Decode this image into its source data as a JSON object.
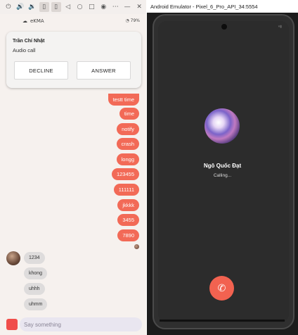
{
  "left": {
    "app_name": "eKMA",
    "battery": "79%",
    "notification": {
      "caller": "Trần Chí Nhật",
      "type": "Audio call",
      "decline_label": "DECLINE",
      "answer_label": "ANSWER"
    },
    "outgoing_messages": [
      "testt time",
      "time",
      "notify",
      "crash",
      "longg",
      "123455",
      "111111",
      "jkkkk",
      "3455",
      "7890"
    ],
    "incoming_messages": [
      "1234",
      "khong",
      "uhhh",
      "uhmm"
    ],
    "input_placeholder": "Say something"
  },
  "right": {
    "window_title": "Android Emulator - Pixel_6_Pro_API_34:5554",
    "callee_name": "Ngô Quốc Đạt",
    "call_status": "Calling...",
    "end_call_icon": "phone-hangup-icon"
  }
}
